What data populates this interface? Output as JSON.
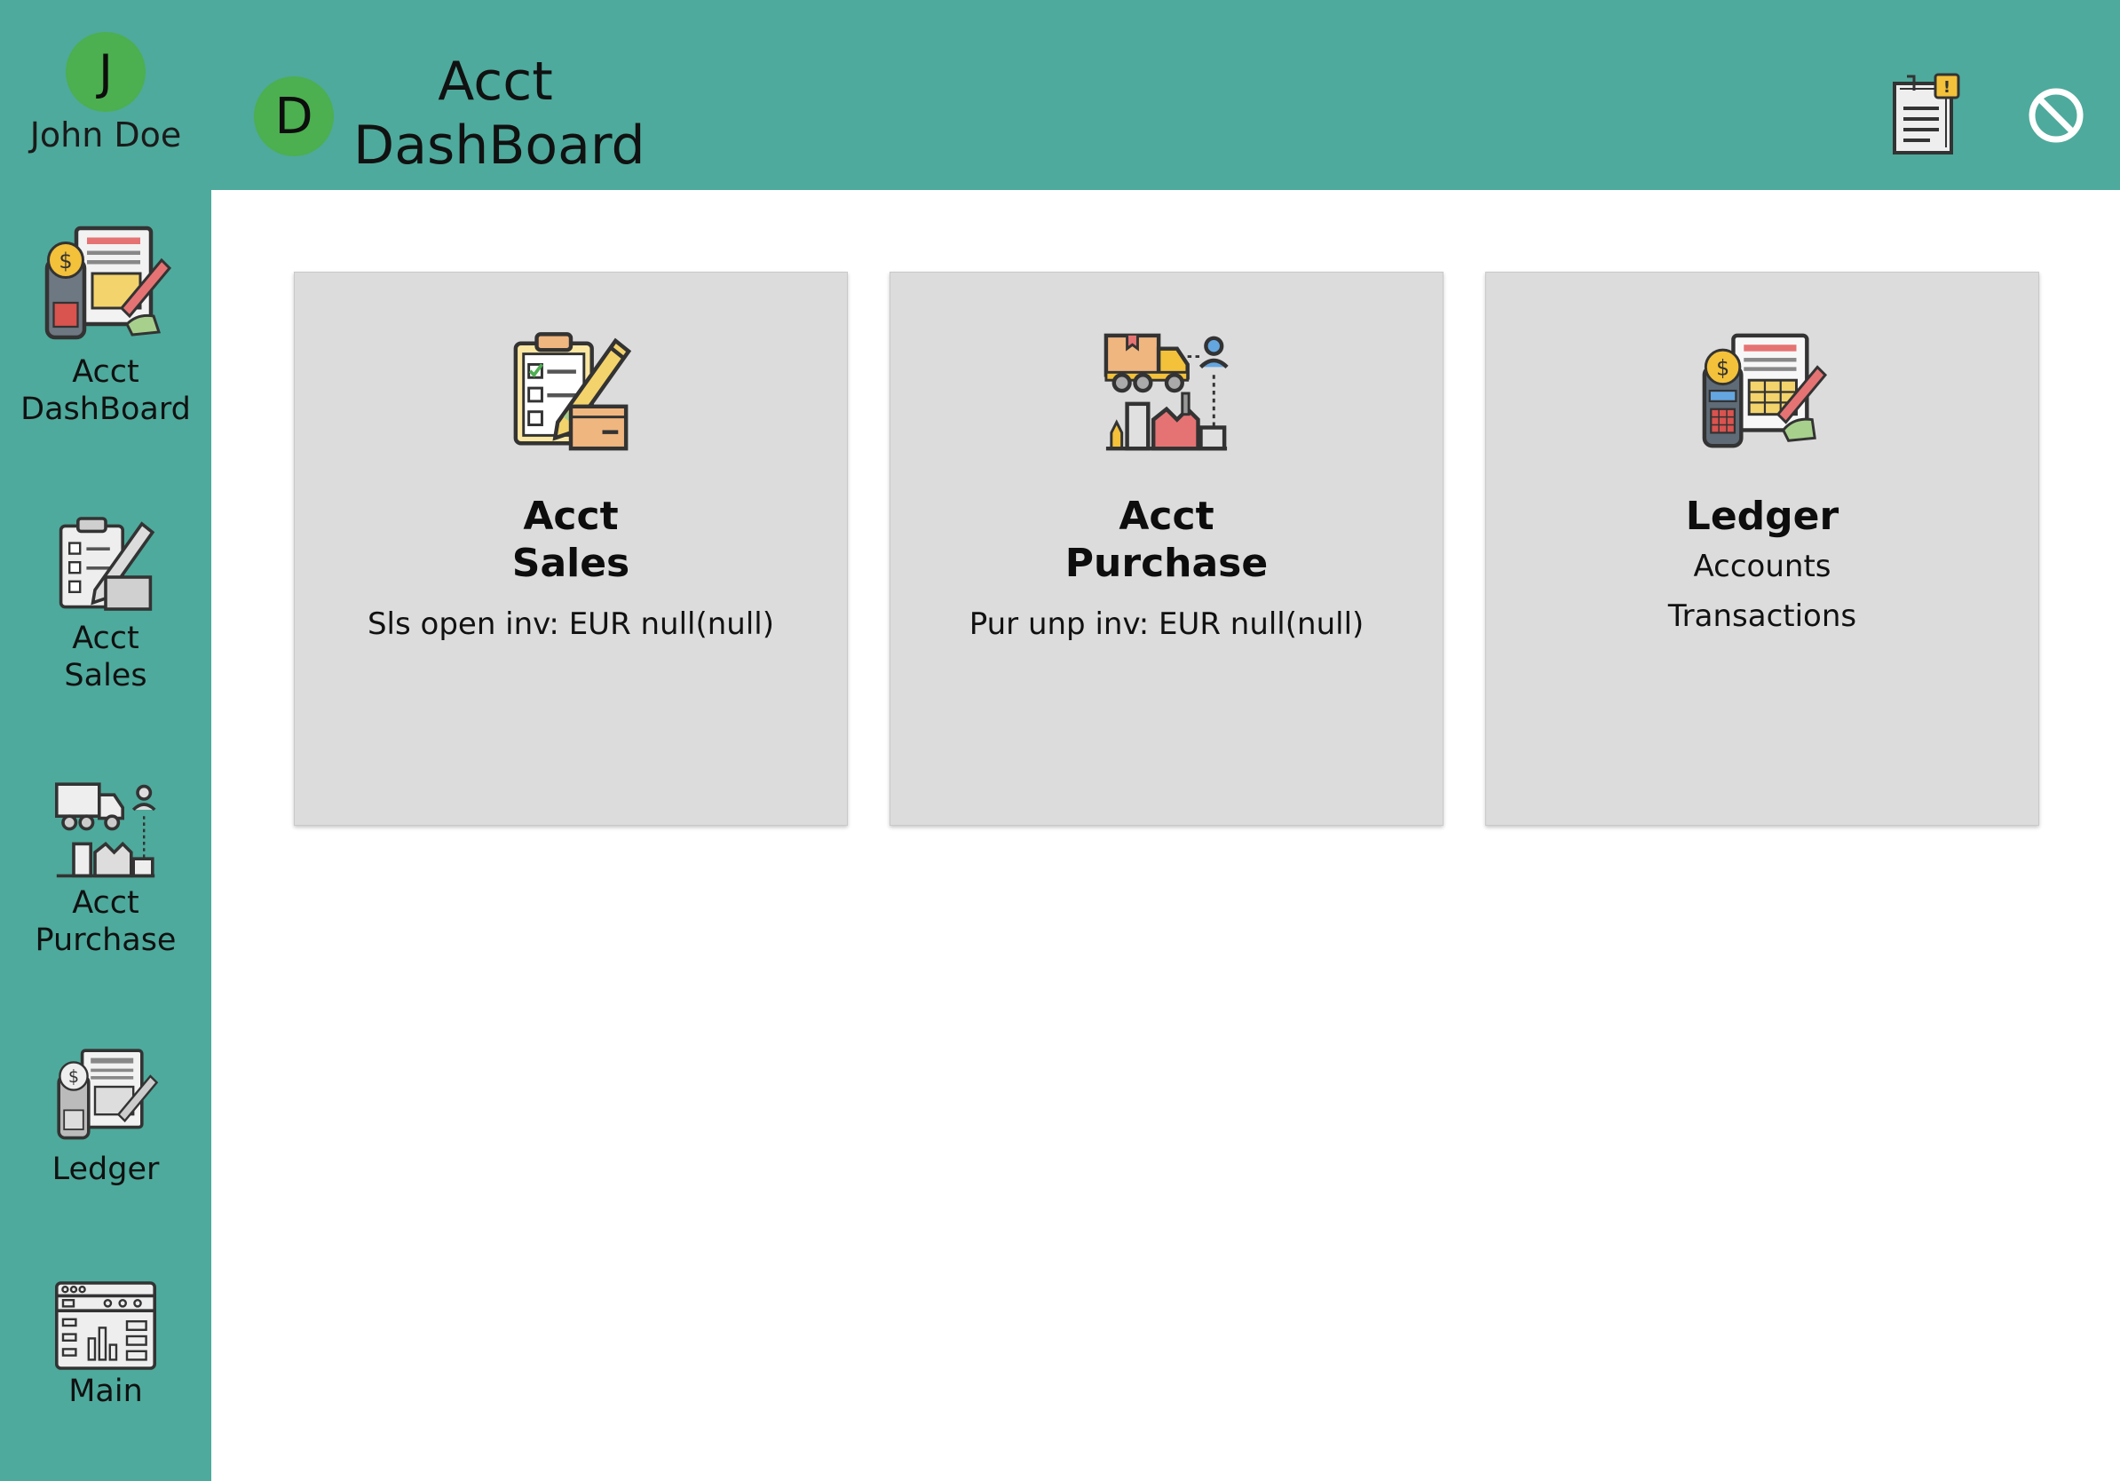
{
  "sidebar": {
    "user": {
      "initial": "J",
      "name": "John Doe"
    },
    "items": [
      {
        "label": "Acct\nDashBoard",
        "icon": "ledger-payment-icon"
      },
      {
        "label": "Acct\nSales",
        "icon": "sales-clipboard-icon"
      },
      {
        "label": "Acct\nPurchase",
        "icon": "purchase-truck-icon"
      },
      {
        "label": "Ledger",
        "icon": "ledger-payment-icon"
      },
      {
        "label": "Main",
        "icon": "dashboard-window-icon"
      }
    ]
  },
  "header": {
    "initial": "D",
    "title": "Acct\nDashBoard",
    "actions": [
      {
        "icon": "notes-alert-icon"
      },
      {
        "icon": "block-icon"
      }
    ]
  },
  "cards": [
    {
      "title": "Acct\nSales",
      "subtitle": "Sls open inv: EUR null(null)",
      "icon": "sales-clipboard-icon"
    },
    {
      "title": "Acct\nPurchase",
      "subtitle": "Pur unp inv: EUR null(null)",
      "icon": "purchase-truck-icon"
    },
    {
      "title": "Ledger",
      "subtitle": "Accounts\nTransactions",
      "icon": "ledger-payment-icon"
    }
  ],
  "colors": {
    "bar": "#4eaa9c",
    "avatar": "#4caf50",
    "card": "#dcdcdc"
  }
}
